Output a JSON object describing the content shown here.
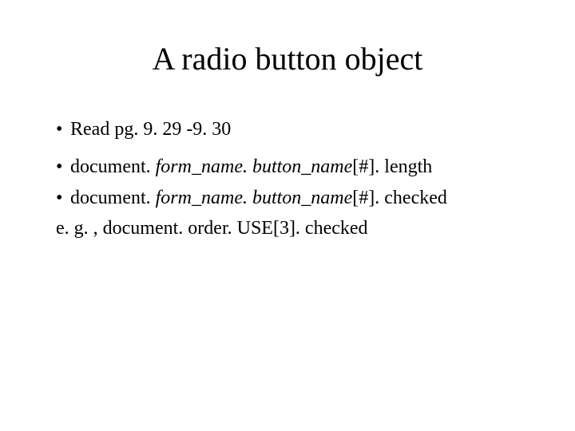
{
  "title": "A radio button object",
  "bullets": {
    "b1": "Read pg. 9. 29 -9. 30",
    "b2": {
      "pre": "document. ",
      "i1": "form_name. button_name",
      "post": "[#]. length"
    },
    "b3": {
      "pre": "document. ",
      "i1": "form_name. button_name",
      "post": "[#]. checked"
    },
    "eg": "e. g. , document. order. USE[3]. checked"
  },
  "marker": "•"
}
